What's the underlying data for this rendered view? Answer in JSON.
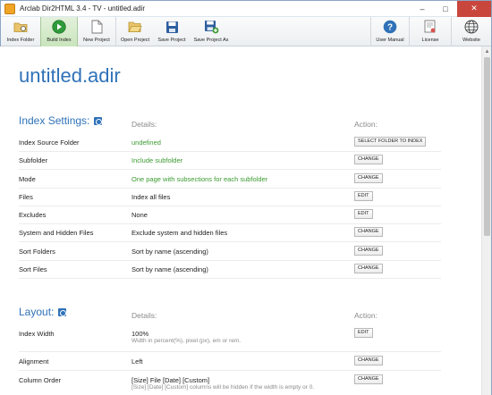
{
  "window": {
    "title": "Arclab Dir2HTML 3.4 - TV - untitled.adir",
    "min": "–",
    "max": "□",
    "close": "✕"
  },
  "toolbar": {
    "index_folder": "Index Folder",
    "build_index": "Build Index",
    "new_project": "New Project",
    "open_project": "Open Project",
    "save_project": "Save Project",
    "save_project_as": "Save Project As",
    "user_manual": "User Manual",
    "license": "License",
    "website": "Website"
  },
  "doc_title": "untitled.adir",
  "index_settings": {
    "title": "Index Settings:",
    "details_head": "Details:",
    "action_head": "Action:",
    "rows": [
      {
        "name": "Index Source Folder",
        "detail": "undefined",
        "button": "SELECT FOLDER TO INDEX"
      },
      {
        "name": "Subfolder",
        "detail": "Include subfolder",
        "button": "CHANGE"
      },
      {
        "name": "Mode",
        "detail": "One page with subsections for each subfolder",
        "button": "CHANGE"
      },
      {
        "name": "Files",
        "detail": "Index all files",
        "button": "EDIT"
      },
      {
        "name": "Excludes",
        "detail": "None",
        "button": "EDIT"
      },
      {
        "name": "System and Hidden Files",
        "detail": "Exclude system and hidden files",
        "button": "CHANGE"
      },
      {
        "name": "Sort Folders",
        "detail": "Sort by name (ascending)",
        "button": "CHANGE"
      },
      {
        "name": "Sort Files",
        "detail": "Sort by name (ascending)",
        "button": "CHANGE"
      }
    ]
  },
  "layout": {
    "title": "Layout:",
    "details_head": "Details:",
    "action_head": "Action:",
    "rows": [
      {
        "name": "Index Width",
        "detail": "100%",
        "sub": "Width in percent(%), pixel (px), em or rem.",
        "button": "EDIT"
      },
      {
        "name": "Alignment",
        "detail": "Left",
        "button": "CHANGE"
      },
      {
        "name": "Column Order",
        "detail": "[Size] File [Date] [Custom]",
        "sub": "[Size] [Date] [Custom] columns will be hidden if the width is empty or 0.",
        "button": "CHANGE"
      }
    ]
  },
  "colors": {
    "accent": "#2f72b8",
    "green": "#3a9a2f"
  }
}
